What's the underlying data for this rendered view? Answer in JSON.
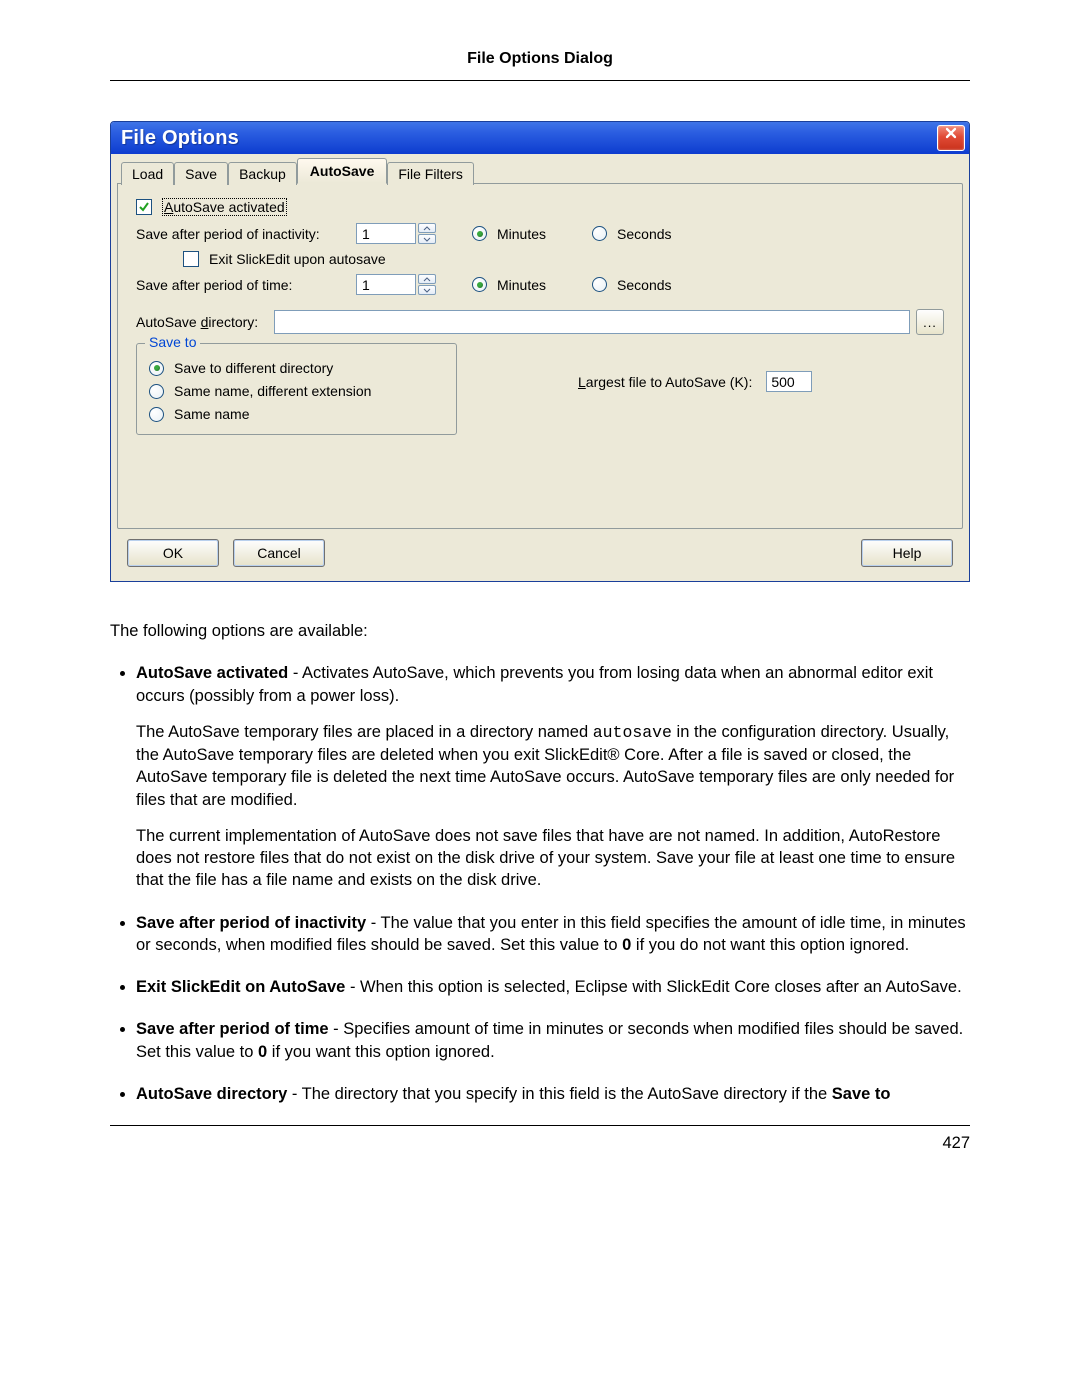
{
  "page": {
    "header": "File Options Dialog",
    "number": "427"
  },
  "dialog": {
    "title": "File Options",
    "tabs": [
      "Load",
      "Save",
      "Backup",
      "AutoSave",
      "File Filters"
    ],
    "activated_label": "AutoSave activated",
    "inactivity_label": "Save after period of inactivity:",
    "inactivity_value": "1",
    "exit_label": "Exit SlickEdit upon autosave",
    "period_label": "Save after period of time:",
    "period_value": "1",
    "minutes_label": "Minutes",
    "seconds_label": "Seconds",
    "dir_label": "AutoSave directory:",
    "browse_label": "...",
    "saveto_legend": "Save to",
    "saveto_opt1": "Save to different directory",
    "saveto_opt2": "Same name, different extension",
    "saveto_opt3": "Same name",
    "largest_label": "Largest file to AutoSave (K):",
    "largest_value": "500",
    "ok": "OK",
    "cancel": "Cancel",
    "help": "Help"
  },
  "text": {
    "intro": "The following options are available:",
    "b1_t": "AutoSave activated",
    "b1_a": " - Activates AutoSave, which prevents you from losing data when an abnormal editor exit occurs (possibly from a power loss).",
    "b1_p2a": "The AutoSave temporary files are placed in a directory named ",
    "b1_p2_code": "autosave",
    "b1_p2b": " in the configuration directory. Usually, the AutoSave temporary files are deleted when you exit SlickEdit® Core. After a file is saved or closed, the AutoSave temporary file is deleted the next time AutoSave occurs. AutoSave temporary files are only needed for files that are modified.",
    "b1_p3": "The current implementation of AutoSave does not save files that have are not named. In addition, AutoRestore does not restore files that do not exist on the disk drive of your system. Save your file at least one time to ensure that the file has a file name and exists on the disk drive.",
    "b2_t": "Save after period of inactivity",
    "b2_a": " - The value that you enter in this field specifies the amount of idle time, in minutes or seconds, when modified files should be saved. Set this value to ",
    "b2_zero": "0",
    "b2_b": " if you do not want this option ignored.",
    "b3_t": "Exit SlickEdit on AutoSave",
    "b3_a": " - When this option is selected, Eclipse with SlickEdit Core closes after an AutoSave.",
    "b4_t": "Save after period of time",
    "b4_a": " - Specifies amount of time in minutes or seconds when modified files should be saved. Set this value to ",
    "b4_zero": "0",
    "b4_b": " if you want this option ignored.",
    "b5_t": "AutoSave directory",
    "b5_a": " - The directory that you specify in this field is the AutoSave directory if the ",
    "b5_bold": "Save to"
  }
}
